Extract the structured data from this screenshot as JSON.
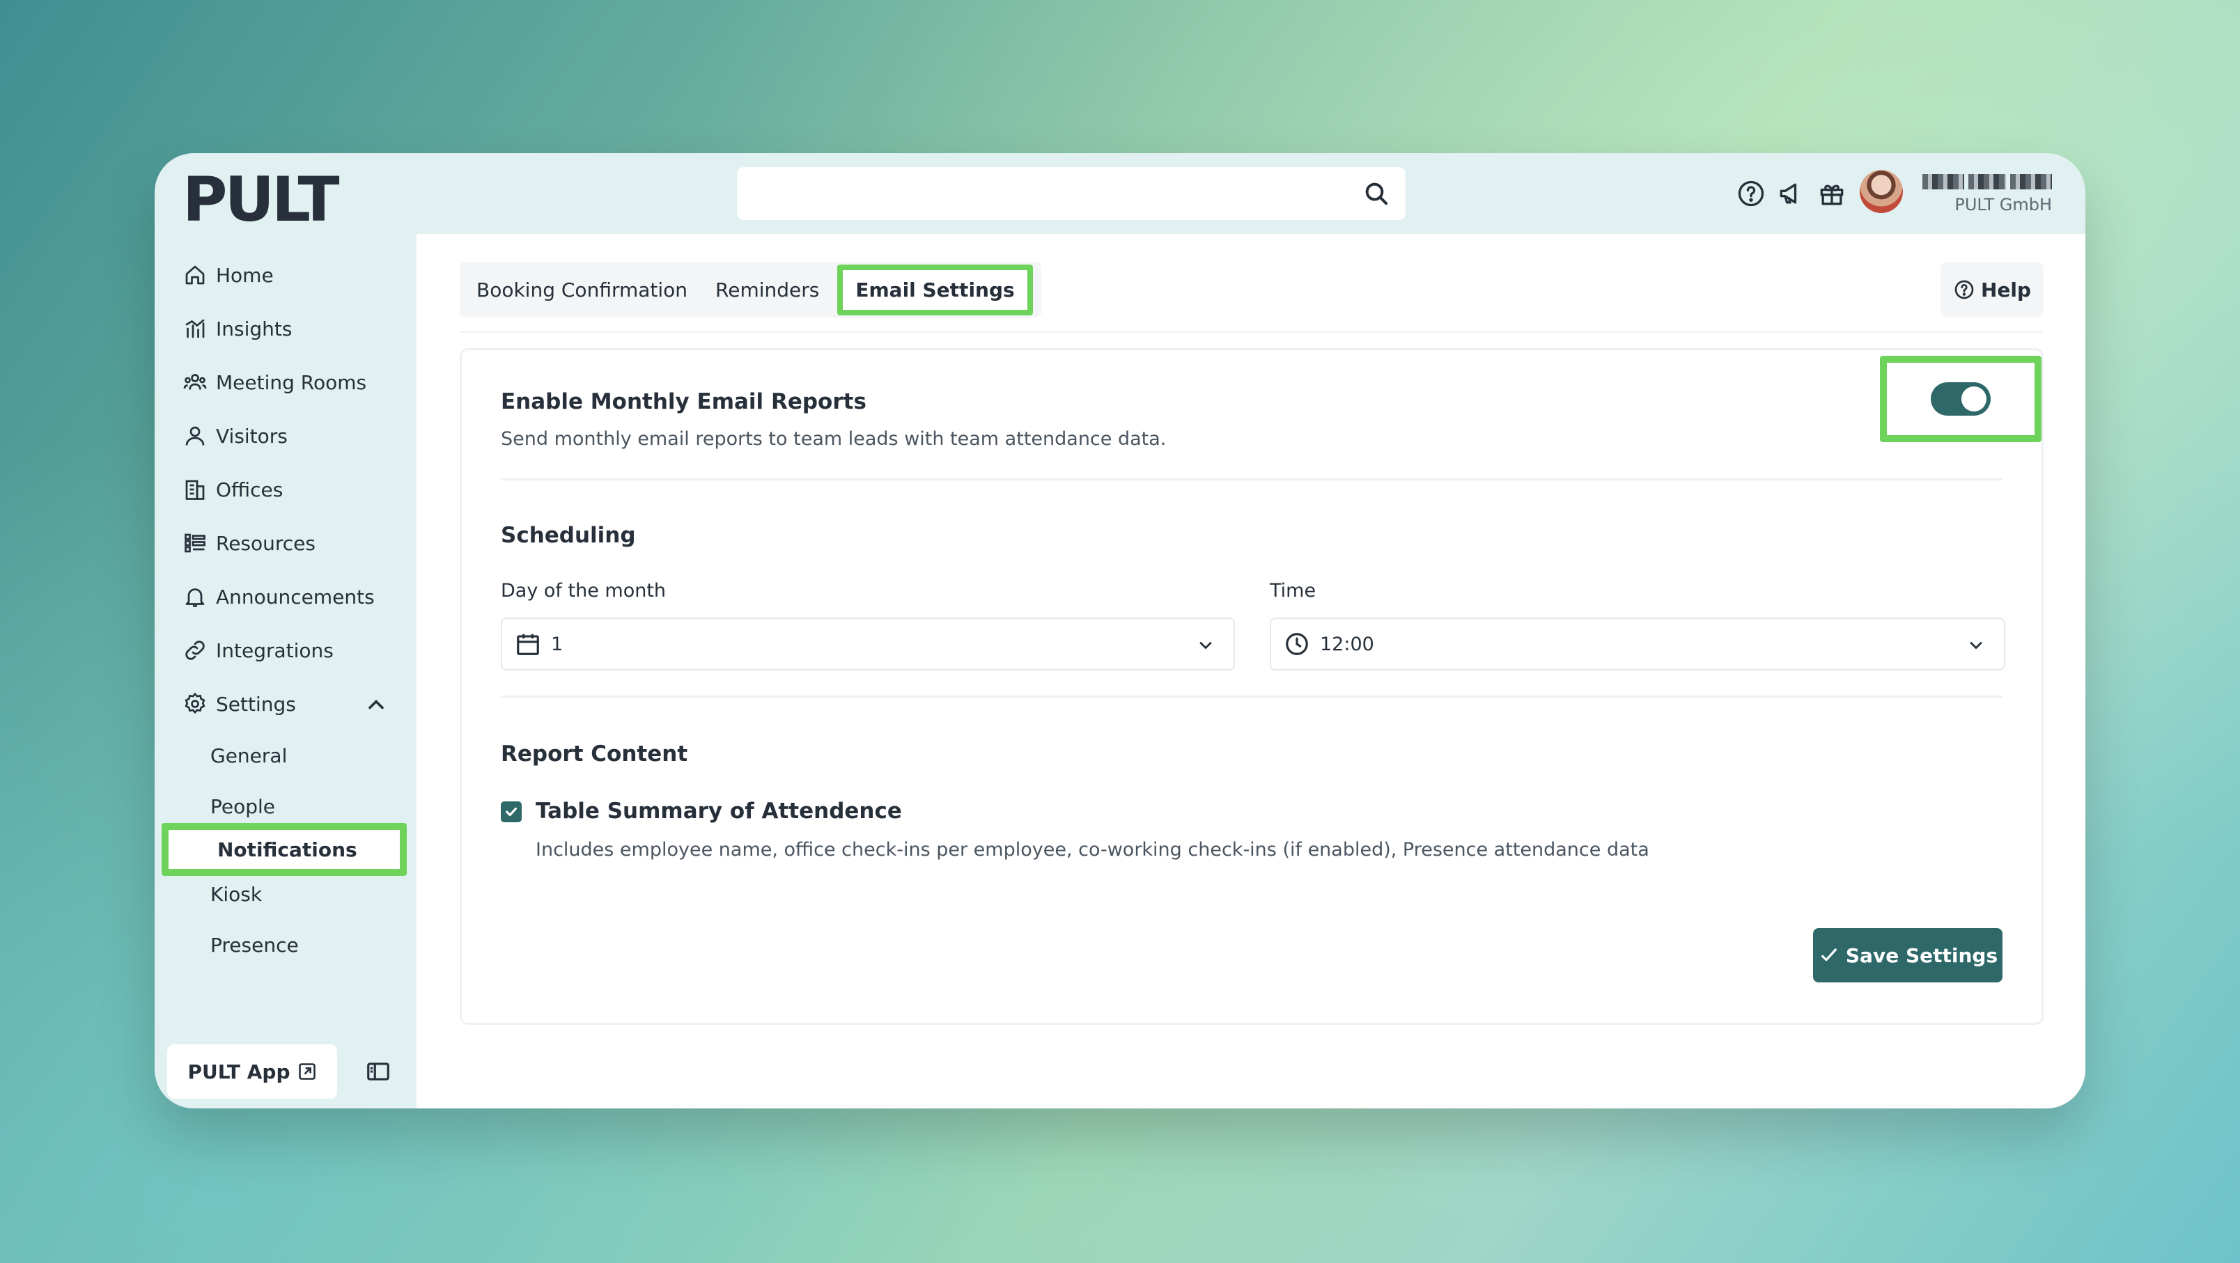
{
  "app": {
    "logo": "PULT"
  },
  "header": {
    "search": {
      "placeholder": ""
    },
    "icons": [
      "help-circle-icon",
      "megaphone-icon",
      "gift-icon"
    ],
    "user": {
      "company": "PULT GmbH"
    }
  },
  "sidebar": {
    "items": [
      {
        "label": "Home",
        "icon": "home-icon"
      },
      {
        "label": "Insights",
        "icon": "chart-icon"
      },
      {
        "label": "Meeting Rooms",
        "icon": "people-group-icon"
      },
      {
        "label": "Visitors",
        "icon": "user-icon"
      },
      {
        "label": "Offices",
        "icon": "building-icon"
      },
      {
        "label": "Resources",
        "icon": "list-icon"
      },
      {
        "label": "Announcements",
        "icon": "bell-icon"
      },
      {
        "label": "Integrations",
        "icon": "link-icon"
      },
      {
        "label": "Settings",
        "icon": "gear-icon"
      }
    ],
    "settings_sub": [
      {
        "label": "General"
      },
      {
        "label": "People"
      },
      {
        "label": "Notifications",
        "active": true
      },
      {
        "label": "Kiosk"
      },
      {
        "label": "Presence"
      }
    ],
    "app_button": "PULT App"
  },
  "tabs": [
    {
      "label": "Booking Confirmation"
    },
    {
      "label": "Reminders"
    },
    {
      "label": "Email Settings",
      "active": true
    }
  ],
  "help_label": "Help",
  "monthly": {
    "title": "Enable Monthly Email Reports",
    "description": "Send monthly email reports to team leads with team attendance data.",
    "enabled": true
  },
  "scheduling": {
    "title": "Scheduling",
    "day_label": "Day of the month",
    "day_value": "1",
    "time_label": "Time",
    "time_value": "12:00"
  },
  "report": {
    "title": "Report Content",
    "option_label": "Table Summary of Attendence",
    "option_desc": "Includes employee name, office check-ins per employee, co-working check-ins (if enabled), Presence attendance data",
    "checked": true
  },
  "save_label": "Save Settings",
  "colors": {
    "accent": "#2e6868",
    "highlight": "#6ed35a"
  }
}
